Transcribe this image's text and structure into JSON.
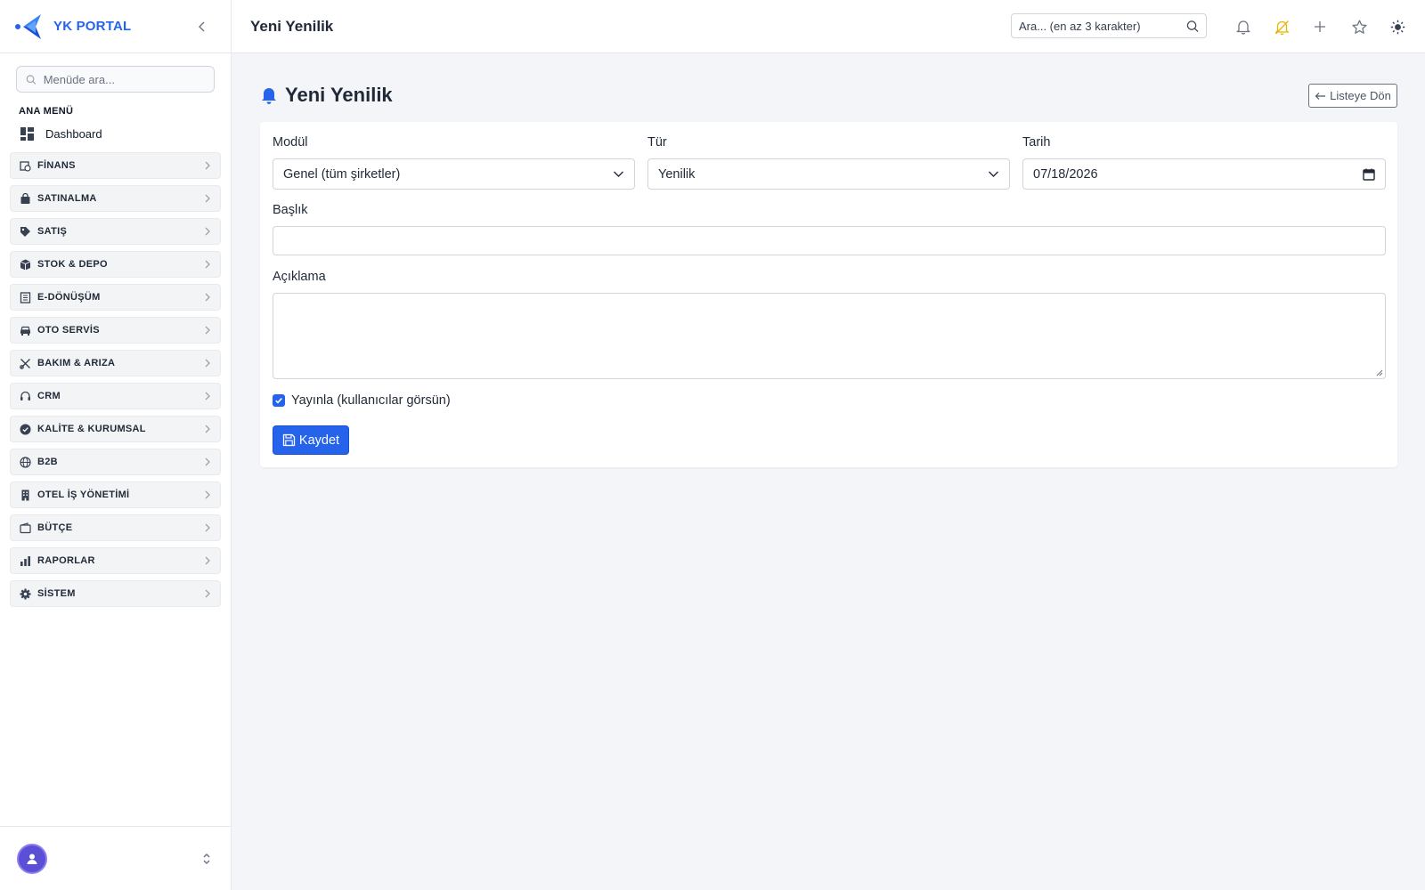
{
  "sidebar": {
    "brand": "YK PORTAL",
    "search_placeholder": "Menüde ara...",
    "section_title": "ANA MENÜ",
    "dashboard_label": "Dashboard",
    "items": [
      {
        "label": "FİNANS",
        "icon": "finance-icon"
      },
      {
        "label": "SATINALMA",
        "icon": "bag-icon"
      },
      {
        "label": "SATIŞ",
        "icon": "tag-icon"
      },
      {
        "label": "STOK & DEPO",
        "icon": "box-icon"
      },
      {
        "label": "E-DÖNÜŞÜM",
        "icon": "document-icon"
      },
      {
        "label": "OTO SERVİS",
        "icon": "car-icon"
      },
      {
        "label": "BAKIM & ARIZA",
        "icon": "tools-icon"
      },
      {
        "label": "CRM",
        "icon": "headset-icon"
      },
      {
        "label": "KALİTE & KURUMSAL",
        "icon": "badge-check-icon"
      },
      {
        "label": "B2B",
        "icon": "globe-icon"
      },
      {
        "label": "OTEL İŞ YÖNETİMİ",
        "icon": "building-icon"
      },
      {
        "label": "BÜTÇE",
        "icon": "wallet-icon"
      },
      {
        "label": "RAPORLAR",
        "icon": "bar-chart-icon"
      },
      {
        "label": "SİSTEM",
        "icon": "gear-icon"
      }
    ]
  },
  "topbar": {
    "title": "Yeni Yenilik",
    "search_placeholder": "Ara... (en az 3 karakter)"
  },
  "main": {
    "title": "Yeni Yenilik",
    "back_label": "Listeye Dön",
    "form": {
      "module_label": "Modül",
      "module_value": "Genel (tüm şirketler)",
      "type_label": "Tür",
      "type_value": "Yenilik",
      "date_label": "Tarih",
      "date_value": "07/18/2026",
      "title_label": "Başlık",
      "title_value": "",
      "description_label": "Açıklama",
      "description_value": "",
      "publish_label": "Yayınla (kullanıcılar görsün)",
      "publish_checked": true,
      "save_label": "Kaydet"
    }
  },
  "colors": {
    "accent": "#2563eb",
    "notification_warning": "#eab308"
  }
}
